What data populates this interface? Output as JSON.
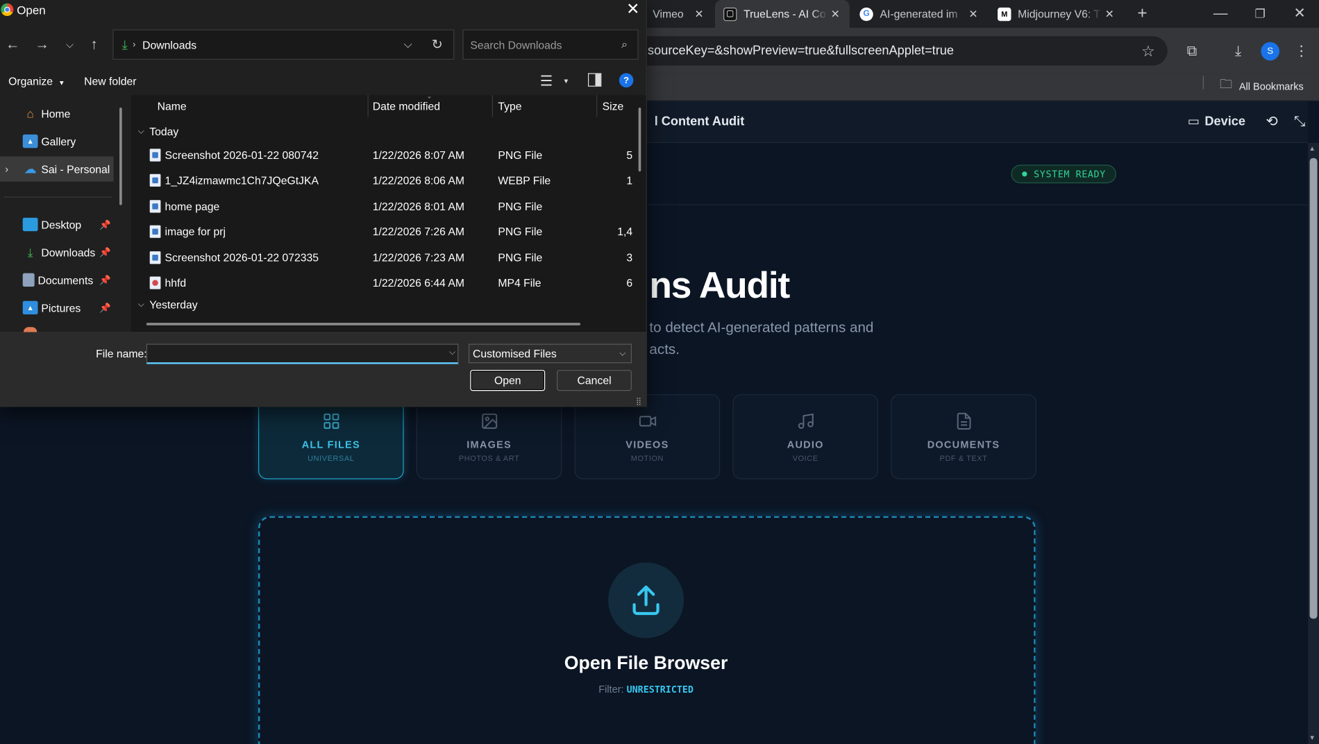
{
  "browser": {
    "tabs": [
      {
        "label": "Vimeo",
        "icon": "vimeo-icon",
        "active": false
      },
      {
        "label": "TrueLens - AI Co",
        "icon": "truelens-icon",
        "active": true
      },
      {
        "label": "AI-generated im",
        "icon": "google-icon",
        "active": false
      },
      {
        "label": "Midjourney V6: T",
        "icon": "medium-icon",
        "active": false
      }
    ],
    "url": "sourceKey=&showPreview=true&fullscreenApplet=true",
    "profile_initial": "S",
    "bookmarks_label": "All Bookmarks"
  },
  "app": {
    "title": "l Content Audit",
    "device_label": "Device",
    "status_badge": "SYSTEM READY",
    "hero_title": "ns Audit",
    "hero_subtitle": "to detect AI-generated patterns and acts.",
    "categories": [
      {
        "name": "ALL FILES",
        "sub": "UNIVERSAL",
        "icon": "grid-icon",
        "selected": true
      },
      {
        "name": "IMAGES",
        "sub": "PHOTOS & ART",
        "icon": "image-icon",
        "selected": false
      },
      {
        "name": "VIDEOS",
        "sub": "MOTION",
        "icon": "video-icon",
        "selected": false
      },
      {
        "name": "AUDIO",
        "sub": "VOICE",
        "icon": "music-icon",
        "selected": false
      },
      {
        "name": "DOCUMENTS",
        "sub": "PDF & TEXT",
        "icon": "document-icon",
        "selected": false
      }
    ],
    "drop_title": "Open File Browser",
    "filter_label": "Filter:",
    "filter_value": "UNRESTRICTED"
  },
  "dialog": {
    "title": "Open",
    "path_folder": "Downloads",
    "search_placeholder": "Search Downloads",
    "organize_label": "Organize",
    "new_folder_label": "New folder",
    "nav": [
      {
        "label": "Home",
        "icon": "home-icon"
      },
      {
        "label": "Gallery",
        "icon": "gallery-icon"
      },
      {
        "label": "Sai - Personal",
        "icon": "onedrive-icon",
        "selected": true
      },
      {
        "label": "Desktop",
        "icon": "desktop-icon",
        "pinned": true
      },
      {
        "label": "Downloads",
        "icon": "downloads-icon",
        "pinned": true
      },
      {
        "label": "Documents",
        "icon": "documents-icon",
        "pinned": true
      },
      {
        "label": "Pictures",
        "icon": "pictures-icon",
        "pinned": true
      }
    ],
    "columns": {
      "name": "Name",
      "date": "Date modified",
      "type": "Type",
      "size": "Size"
    },
    "groups": {
      "today": "Today",
      "yesterday": "Yesterday"
    },
    "files": [
      {
        "name": "Screenshot 2026-01-22 080742",
        "date": "1/22/2026 8:07 AM",
        "type": "PNG File",
        "size": "5"
      },
      {
        "name": "1_JZ4izmawmc1Ch7JQeGtJKA",
        "date": "1/22/2026 8:06 AM",
        "type": "WEBP File",
        "size": "1"
      },
      {
        "name": "home page",
        "date": "1/22/2026 8:01 AM",
        "type": "PNG File",
        "size": ""
      },
      {
        "name": "image for prj",
        "date": "1/22/2026 7:26 AM",
        "type": "PNG File",
        "size": "1,4"
      },
      {
        "name": "Screenshot 2026-01-22 072335",
        "date": "1/22/2026 7:23 AM",
        "type": "PNG File",
        "size": "3"
      },
      {
        "name": "hhfd",
        "date": "1/22/2026 6:44 AM",
        "type": "MP4 File",
        "size": "6"
      }
    ],
    "filename_label": "File name:",
    "filename_value": "",
    "filetype": "Customised Files",
    "open_label": "Open",
    "cancel_label": "Cancel"
  }
}
